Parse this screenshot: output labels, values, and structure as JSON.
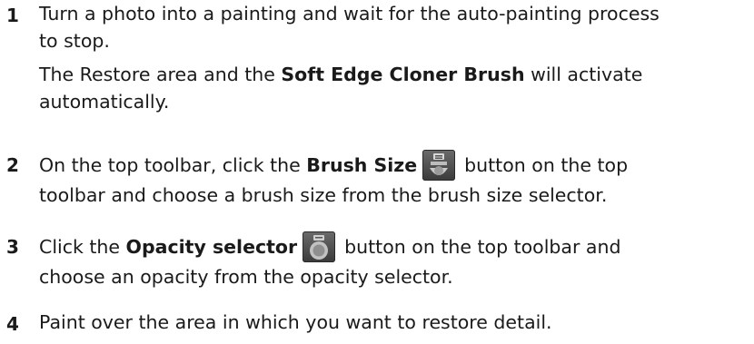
{
  "steps": [
    {
      "number": "1",
      "line1": "Turn a photo into a painting and wait for the auto-painting process",
      "line2": "to stop.",
      "line3_pre": "The Restore area and the ",
      "line3_bold": "Soft Edge Cloner Brush",
      "line3_post": " will activate",
      "line4": "automatically."
    },
    {
      "number": "2",
      "pre": "On the top toolbar, click the ",
      "bold": "Brush Size",
      "post": "button on the top",
      "line2": "toolbar and choose a brush size from the brush size selector.",
      "icon": "brush-size-icon"
    },
    {
      "number": "3",
      "pre": "Click the ",
      "bold": "Opacity selector",
      "post": "button on the top toolbar and",
      "line2": "choose an opacity from the opacity selector.",
      "icon": "opacity-selector-icon"
    },
    {
      "number": "4",
      "line1": "Paint over the area in which you want to restore detail."
    }
  ]
}
